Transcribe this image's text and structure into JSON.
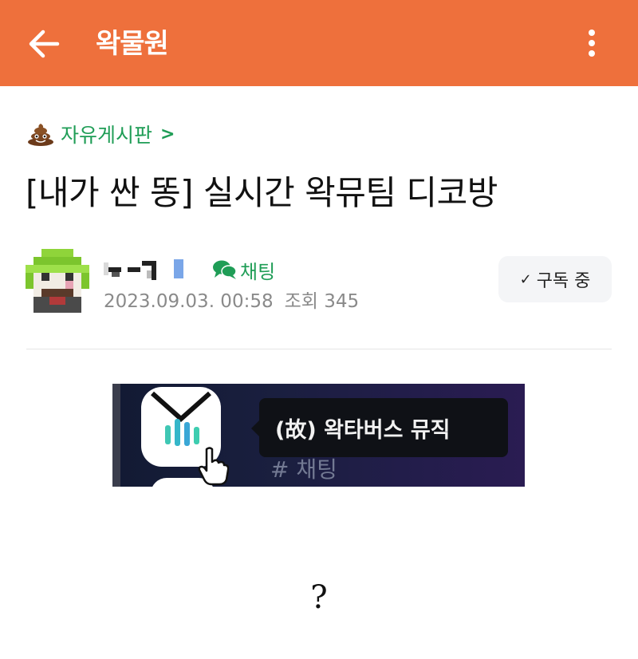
{
  "app_bar": {
    "title": "왁물원",
    "back_icon": "arrow-left-icon",
    "more_icon": "more-vertical-icon",
    "background_color": "#ee703c"
  },
  "post": {
    "board": {
      "label": "자유게시판",
      "icon": "poop-emoji-icon",
      "chevron": ">",
      "color": "#1f9d56"
    },
    "title": "[내가 싼 똥] 실시간 왁뮤팀 디코방",
    "author": {
      "chat_label": "채팅",
      "chat_icon": "chat-bubble-icon",
      "date": "2023.09.03. 00:58",
      "views_label": "조회",
      "views": "345"
    },
    "subscribe_button": {
      "label": "구독 중",
      "icon": "check-icon"
    },
    "image": {
      "tooltip_text": "(故) 왁타버스 뮤직",
      "channel_text": "# 채팅"
    },
    "body": "?"
  }
}
